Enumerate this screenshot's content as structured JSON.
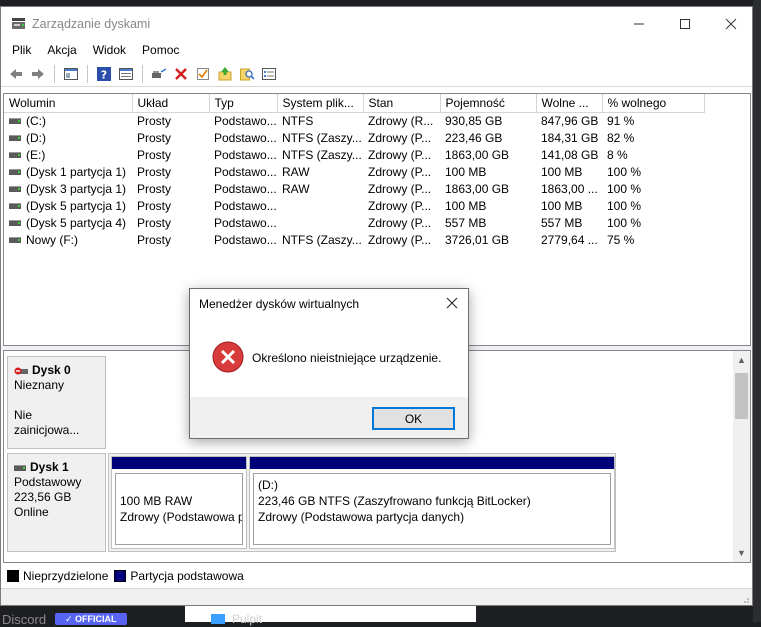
{
  "window": {
    "title": "Zarządzanie dyskami",
    "menu": [
      "Plik",
      "Akcja",
      "Widok",
      "Pomoc"
    ]
  },
  "toolbar_icons": [
    "back-icon",
    "forward-icon",
    "console-icon",
    "help-icon",
    "properties-icon",
    "connect-icon",
    "delete-icon",
    "check-icon",
    "refresh-icon",
    "search-icon",
    "list-icon"
  ],
  "volumes": {
    "headers": [
      "Wolumin",
      "Układ",
      "Typ",
      "System plik...",
      "Stan",
      "Pojemność",
      "Wolne ...",
      "% wolnego"
    ],
    "rows": [
      [
        "(C:)",
        "Prosty",
        "Podstawo...",
        "NTFS",
        "Zdrowy (R...",
        "930,85 GB",
        "847,96 GB",
        "91 %"
      ],
      [
        "(D:)",
        "Prosty",
        "Podstawo...",
        "NTFS (Zaszy...",
        "Zdrowy (P...",
        "223,46 GB",
        "184,31 GB",
        "82 %"
      ],
      [
        "(E:)",
        "Prosty",
        "Podstawo...",
        "NTFS (Zaszy...",
        "Zdrowy (P...",
        "1863,00 GB",
        "141,08 GB",
        "8 %"
      ],
      [
        "(Dysk 1 partycja 1)",
        "Prosty",
        "Podstawo...",
        "RAW",
        "Zdrowy (P...",
        "100 MB",
        "100 MB",
        "100 %"
      ],
      [
        "(Dysk 3 partycja 1)",
        "Prosty",
        "Podstawo...",
        "RAW",
        "Zdrowy (P...",
        "1863,00 GB",
        "1863,00 ...",
        "100 %"
      ],
      [
        "(Dysk 5 partycja 1)",
        "Prosty",
        "Podstawo...",
        "",
        "Zdrowy (P...",
        "100 MB",
        "100 MB",
        "100 %"
      ],
      [
        "(Dysk 5 partycja 4)",
        "Prosty",
        "Podstawo...",
        "",
        "Zdrowy (P...",
        "557 MB",
        "557 MB",
        "100 %"
      ],
      [
        "Nowy (F:)",
        "Prosty",
        "Podstawo...",
        "NTFS (Zaszy...",
        "Zdrowy (P...",
        "3726,01 GB",
        "2779,64 ...",
        "75 %"
      ]
    ]
  },
  "disks": {
    "disk0": {
      "name": "Dysk 0",
      "type": "Nieznany",
      "status": "Nie zainicjowa..."
    },
    "disk1": {
      "name": "Dysk 1",
      "type": "Podstawowy",
      "size": "223,56 GB",
      "status": "Online",
      "partitions": [
        {
          "letter": "",
          "line1": "100 MB RAW",
          "line2": "Zdrowy (Podstawowa p"
        },
        {
          "letter": "(D:)",
          "line1": "223,46 GB NTFS (Zaszyfrowano funkcją BitLocker)",
          "line2": "Zdrowy (Podstawowa partycja danych)"
        }
      ]
    }
  },
  "legend": [
    {
      "label": "Nieprzydzielone",
      "color": "#000000"
    },
    {
      "label": "Partycja podstawowa",
      "color": "#00007a"
    }
  ],
  "dialog": {
    "title": "Menedżer dysków wirtualnych",
    "message": "Określono nieistniejące urządzenie.",
    "ok_label": "OK",
    "icon": "error-icon"
  },
  "background": {
    "discord": "Discord",
    "badge": "✓ OFFICIAL",
    "pulpit": "Pulpit"
  }
}
